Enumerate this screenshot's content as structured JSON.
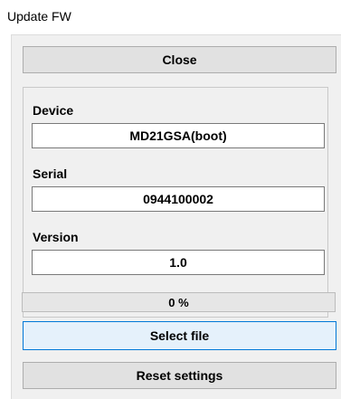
{
  "window": {
    "title": "Update FW"
  },
  "buttons": {
    "close_label": "Close",
    "select_file_label": "Select file",
    "reset_settings_label": "Reset settings"
  },
  "device_info": {
    "device_label": "Device",
    "device_value": "MD21GSA(boot)",
    "serial_label": "Serial",
    "serial_value": "0944100002",
    "version_label": "Version",
    "version_value": "1.0"
  },
  "progress": {
    "percent": 0,
    "text": "0 %"
  },
  "colors": {
    "button_face": "#e1e1e1",
    "focused_button_face": "#e5f1fb",
    "focus_border": "#0078d7",
    "window_background": "#f0f0f0",
    "progress_fill": "#06b025"
  }
}
